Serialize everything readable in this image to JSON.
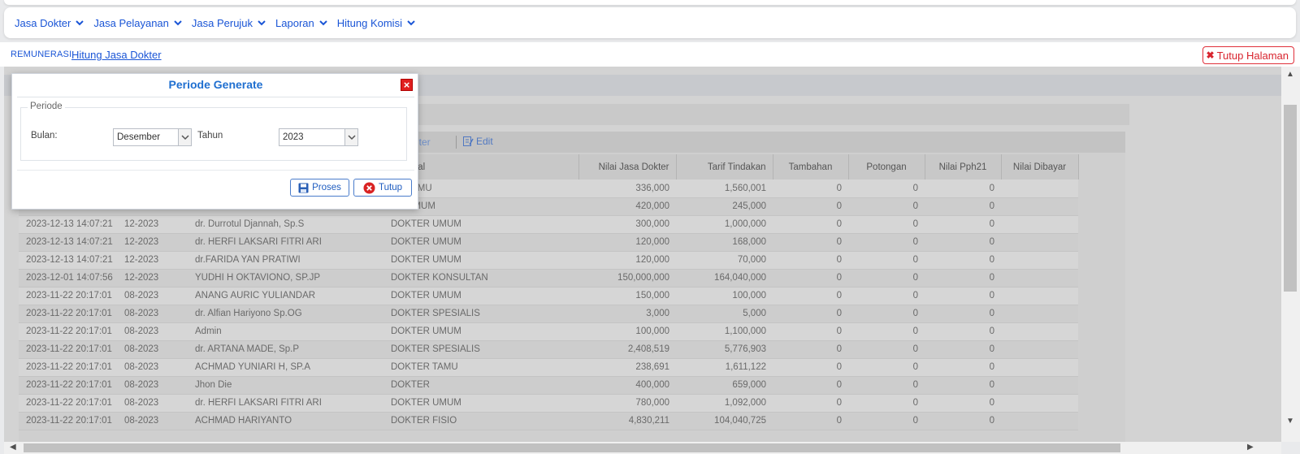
{
  "menu": [
    {
      "label": "Jasa Dokter"
    },
    {
      "label": "Jasa Pelayanan"
    },
    {
      "label": "Jasa Perujuk"
    },
    {
      "label": "Laporan"
    },
    {
      "label": "Hitung Komisi"
    }
  ],
  "breadcrumb": {
    "root": "REMUNERASI",
    "current": "Hitung Jasa Dokter"
  },
  "close_page_label": "Tutup Halaman",
  "toolbar": {
    "filter_label": "lter",
    "edit_label": "Edit"
  },
  "table": {
    "columns": [
      "",
      "",
      "",
      "onal",
      "Nilai Jasa Dokter",
      "Tarif Tindakan",
      "Tambahan",
      "Potongan",
      "Nilai Pph21",
      "Nilai Dibayar"
    ],
    "rows": [
      {
        "tanggal": "",
        "periode": "",
        "dokter": "",
        "profesi": "ER TAMU",
        "jasa": "336,000",
        "tarif": "1,560,001",
        "tambahan": "0",
        "potongan": "0",
        "pph21": "0",
        "dibayar": ""
      },
      {
        "tanggal": "",
        "periode": "",
        "dokter": "",
        "profesi": "ER UMUM",
        "jasa": "420,000",
        "tarif": "245,000",
        "tambahan": "0",
        "potongan": "0",
        "pph21": "0",
        "dibayar": ""
      },
      {
        "tanggal": "2023-12-13 14:07:21",
        "periode": "12-2023",
        "dokter": "dr. Durrotul Djannah, Sp.S",
        "profesi": "DOKTER UMUM",
        "jasa": "300,000",
        "tarif": "1,000,000",
        "tambahan": "0",
        "potongan": "0",
        "pph21": "0",
        "dibayar": ""
      },
      {
        "tanggal": "2023-12-13 14:07:21",
        "periode": "12-2023",
        "dokter": "dr. HERFI LAKSARI FITRI ARI",
        "profesi": "DOKTER UMUM",
        "jasa": "120,000",
        "tarif": "168,000",
        "tambahan": "0",
        "potongan": "0",
        "pph21": "0",
        "dibayar": ""
      },
      {
        "tanggal": "2023-12-13 14:07:21",
        "periode": "12-2023",
        "dokter": "dr.FARIDA YAN PRATIWI",
        "profesi": "DOKTER UMUM",
        "jasa": "120,000",
        "tarif": "70,000",
        "tambahan": "0",
        "potongan": "0",
        "pph21": "0",
        "dibayar": ""
      },
      {
        "tanggal": "2023-12-01 14:07:56",
        "periode": "12-2023",
        "dokter": "YUDHI H OKTAVIONO, SP.JP",
        "profesi": "DOKTER KONSULTAN",
        "jasa": "150,000,000",
        "tarif": "164,040,000",
        "tambahan": "0",
        "potongan": "0",
        "pph21": "0",
        "dibayar": ""
      },
      {
        "tanggal": "2023-11-22 20:17:01",
        "periode": "08-2023",
        "dokter": "ANANG AURIC YULIANDAR",
        "profesi": "DOKTER UMUM",
        "jasa": "150,000",
        "tarif": "100,000",
        "tambahan": "0",
        "potongan": "0",
        "pph21": "0",
        "dibayar": ""
      },
      {
        "tanggal": "2023-11-22 20:17:01",
        "periode": "08-2023",
        "dokter": "dr. Alfian Hariyono Sp.OG",
        "profesi": "DOKTER SPESIALIS",
        "jasa": "3,000",
        "tarif": "5,000",
        "tambahan": "0",
        "potongan": "0",
        "pph21": "0",
        "dibayar": ""
      },
      {
        "tanggal": "2023-11-22 20:17:01",
        "periode": "08-2023",
        "dokter": "Admin",
        "profesi": "DOKTER UMUM",
        "jasa": "100,000",
        "tarif": "1,100,000",
        "tambahan": "0",
        "potongan": "0",
        "pph21": "0",
        "dibayar": ""
      },
      {
        "tanggal": "2023-11-22 20:17:01",
        "periode": "08-2023",
        "dokter": "dr. ARTANA MADE, Sp.P",
        "profesi": "DOKTER SPESIALIS",
        "jasa": "2,408,519",
        "tarif": "5,776,903",
        "tambahan": "0",
        "potongan": "0",
        "pph21": "0",
        "dibayar": ""
      },
      {
        "tanggal": "2023-11-22 20:17:01",
        "periode": "08-2023",
        "dokter": "ACHMAD YUNIARI H, SP.A",
        "profesi": "DOKTER TAMU",
        "jasa": "238,691",
        "tarif": "1,611,122",
        "tambahan": "0",
        "potongan": "0",
        "pph21": "0",
        "dibayar": ""
      },
      {
        "tanggal": "2023-11-22 20:17:01",
        "periode": "08-2023",
        "dokter": "Jhon Die",
        "profesi": "DOKTER",
        "jasa": "400,000",
        "tarif": "659,000",
        "tambahan": "0",
        "potongan": "0",
        "pph21": "0",
        "dibayar": ""
      },
      {
        "tanggal": "2023-11-22 20:17:01",
        "periode": "08-2023",
        "dokter": "dr. HERFI LAKSARI FITRI ARI",
        "profesi": "DOKTER UMUM",
        "jasa": "780,000",
        "tarif": "1,092,000",
        "tambahan": "0",
        "potongan": "0",
        "pph21": "0",
        "dibayar": ""
      },
      {
        "tanggal": "2023-11-22 20:17:01",
        "periode": "08-2023",
        "dokter": "ACHMAD HARIYANTO",
        "profesi": "DOKTER FISIO",
        "jasa": "4,830,211",
        "tarif": "104,040,725",
        "tambahan": "0",
        "potongan": "0",
        "pph21": "0",
        "dibayar": ""
      }
    ]
  },
  "modal": {
    "title": "Periode Generate",
    "fieldset_legend": "Periode",
    "bulan_label": "Bulan:",
    "bulan_value": "Desember",
    "tahun_label": "Tahun",
    "tahun_value": "2023",
    "proses_label": "Proses",
    "tutup_label": "Tutup"
  }
}
